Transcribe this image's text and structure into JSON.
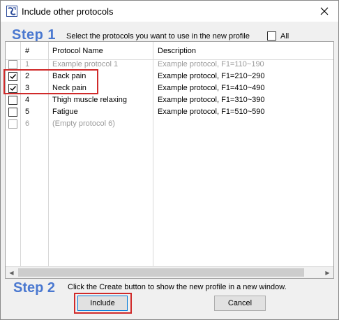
{
  "window": {
    "title": "Include other protocols"
  },
  "step1": {
    "label": "Step 1",
    "description": "Select the protocols you want to use in the new profile",
    "all_label": "All",
    "all_checked": false
  },
  "table": {
    "columns": [
      "#",
      "Protocol Name",
      "Description"
    ],
    "rows": [
      {
        "checked": false,
        "enabled": false,
        "num": "1",
        "name": "Example protocol 1",
        "description": "Example protocol, F1=110~190"
      },
      {
        "checked": true,
        "enabled": true,
        "num": "2",
        "name": "Back pain",
        "description": "Example protocol, F1=210~290"
      },
      {
        "checked": true,
        "enabled": true,
        "num": "3",
        "name": "Neck pain",
        "description": "Example protocol, F1=410~490"
      },
      {
        "checked": false,
        "enabled": true,
        "num": "4",
        "name": "Thigh muscle relaxing",
        "description": "Example protocol, F1=310~390"
      },
      {
        "checked": false,
        "enabled": true,
        "num": "5",
        "name": "Fatigue",
        "description": "Example protocol, F1=510~590"
      },
      {
        "checked": false,
        "enabled": false,
        "num": "6",
        "name": "(Empty protocol 6)",
        "description": ""
      }
    ]
  },
  "step2": {
    "label": "Step 2",
    "description": "Click the Create button to show the new profile in a new window."
  },
  "buttons": {
    "include": "Include",
    "cancel": "Cancel"
  },
  "colors": {
    "step_accent": "#4a78d0",
    "highlight": "#d02a2a"
  },
  "icons": {
    "app": "app-logo-icon",
    "close": "close-icon",
    "check": "checkmark-icon"
  }
}
